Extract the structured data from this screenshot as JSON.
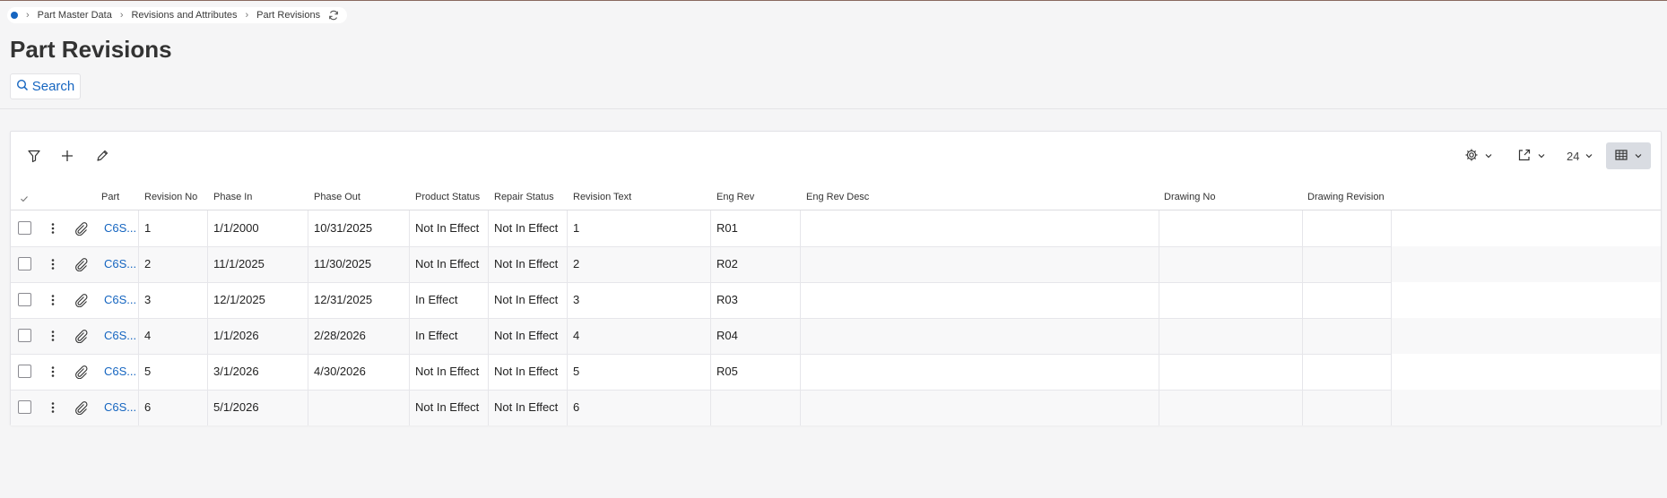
{
  "breadcrumb": {
    "items": [
      "Part Master Data",
      "Revisions and Attributes",
      "Part Revisions"
    ]
  },
  "page": {
    "title": "Part Revisions"
  },
  "search": {
    "label": "Search"
  },
  "toolbar": {
    "page_size": "24"
  },
  "table": {
    "headers": {
      "part": "Part",
      "revision_no": "Revision No",
      "phase_in": "Phase In",
      "phase_out": "Phase Out",
      "product_status": "Product Status",
      "repair_status": "Repair Status",
      "revision_text": "Revision Text",
      "eng_rev": "Eng Rev",
      "eng_rev_desc": "Eng Rev Desc",
      "drawing_no": "Drawing No",
      "drawing_revision": "Drawing Revision"
    },
    "rows": [
      {
        "part": "C6S...",
        "revision_no": "1",
        "phase_in": "1/1/2000",
        "phase_out": "10/31/2025",
        "product_status": "Not In Effect",
        "repair_status": "Not In Effect",
        "revision_text": "1",
        "eng_rev": "R01",
        "eng_rev_desc": "",
        "drawing_no": "",
        "drawing_revision": ""
      },
      {
        "part": "C6S...",
        "revision_no": "2",
        "phase_in": "11/1/2025",
        "phase_out": "11/30/2025",
        "product_status": "Not In Effect",
        "repair_status": "Not In Effect",
        "revision_text": "2",
        "eng_rev": "R02",
        "eng_rev_desc": "",
        "drawing_no": "",
        "drawing_revision": ""
      },
      {
        "part": "C6S...",
        "revision_no": "3",
        "phase_in": "12/1/2025",
        "phase_out": "12/31/2025",
        "product_status": "In Effect",
        "repair_status": "Not In Effect",
        "revision_text": "3",
        "eng_rev": "R03",
        "eng_rev_desc": "",
        "drawing_no": "",
        "drawing_revision": ""
      },
      {
        "part": "C6S...",
        "revision_no": "4",
        "phase_in": "1/1/2026",
        "phase_out": "2/28/2026",
        "product_status": "In Effect",
        "repair_status": "Not In Effect",
        "revision_text": "4",
        "eng_rev": "R04",
        "eng_rev_desc": "",
        "drawing_no": "",
        "drawing_revision": ""
      },
      {
        "part": "C6S...",
        "revision_no": "5",
        "phase_in": "3/1/2026",
        "phase_out": "4/30/2026",
        "product_status": "Not In Effect",
        "repair_status": "Not In Effect",
        "revision_text": "5",
        "eng_rev": "R05",
        "eng_rev_desc": "",
        "drawing_no": "",
        "drawing_revision": ""
      },
      {
        "part": "C6S...",
        "revision_no": "6",
        "phase_in": "5/1/2026",
        "phase_out": "",
        "product_status": "Not In Effect",
        "repair_status": "Not In Effect",
        "revision_text": "6",
        "eng_rev": "",
        "eng_rev_desc": "",
        "drawing_no": "",
        "drawing_revision": ""
      }
    ]
  },
  "colors": {
    "accent": "#1565c0",
    "background": "#f5f5f6"
  }
}
